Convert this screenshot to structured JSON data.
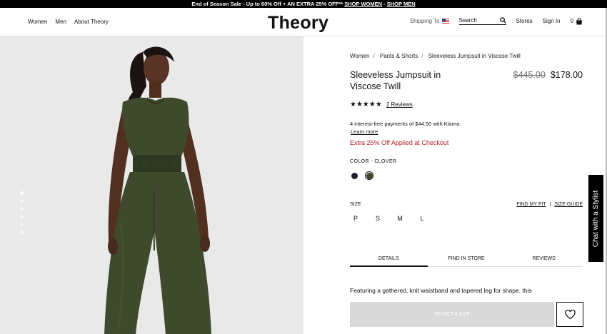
{
  "promo": {
    "text": "End of Season Sale - Up to 60% Off + AN EXTRA 25% OFF**",
    "link_women": "SHOP WOMEN",
    "separator": " - ",
    "link_men": "SHOP MEN"
  },
  "nav": {
    "left": [
      "Women",
      "Men",
      "About Theory"
    ],
    "logo": "Theory",
    "shipping": "Shipping To",
    "search_label": "Search",
    "stores": "Stores",
    "sign_in": "Sign In",
    "bag_count": "0"
  },
  "gallery": {
    "slide_count": 6,
    "active_slide": 1
  },
  "breadcrumb": [
    "Women",
    "Pants & Shorts",
    "Sleeveless Jumpsuit in Viscose Twill"
  ],
  "product": {
    "title": "Sleeveless Jumpsuit in Viscose Twill",
    "original_price": "$445.00",
    "sale_price": "$178.00",
    "stars": "★★★★★",
    "rating": 5,
    "reviews": "2 Reviews",
    "klarna": "4 interest-free payments of $44.50 with Klarna.",
    "klarna_link": "Learn more",
    "promo_note": "Extra 25% Off Applied at Checkout",
    "color_label": "COLOR -  CLOVER",
    "colors": [
      {
        "name": "navy",
        "hex": "#1c1f2b"
      },
      {
        "name": "clover",
        "hex": "#3d4a2a",
        "selected": true
      }
    ],
    "size_label": "SIZE",
    "find_fit": "FIND MY FIT",
    "size_sep": "|",
    "size_guide": "SIZE GUIDE",
    "sizes": [
      "P",
      "S",
      "M",
      "L"
    ],
    "tabs": [
      "DETAILS",
      "FIND IN STORE",
      "REVIEWS"
    ],
    "description": "Featuring a gathered, knit waistband and tapered leg for shape, this",
    "add_button": "SELECT A SIZE"
  },
  "chat": "Chat with a Stylist",
  "colors": {
    "accent_red": "#b31f24",
    "jumpsuit": "#3f4a2c",
    "background": "#e9e9ea"
  }
}
